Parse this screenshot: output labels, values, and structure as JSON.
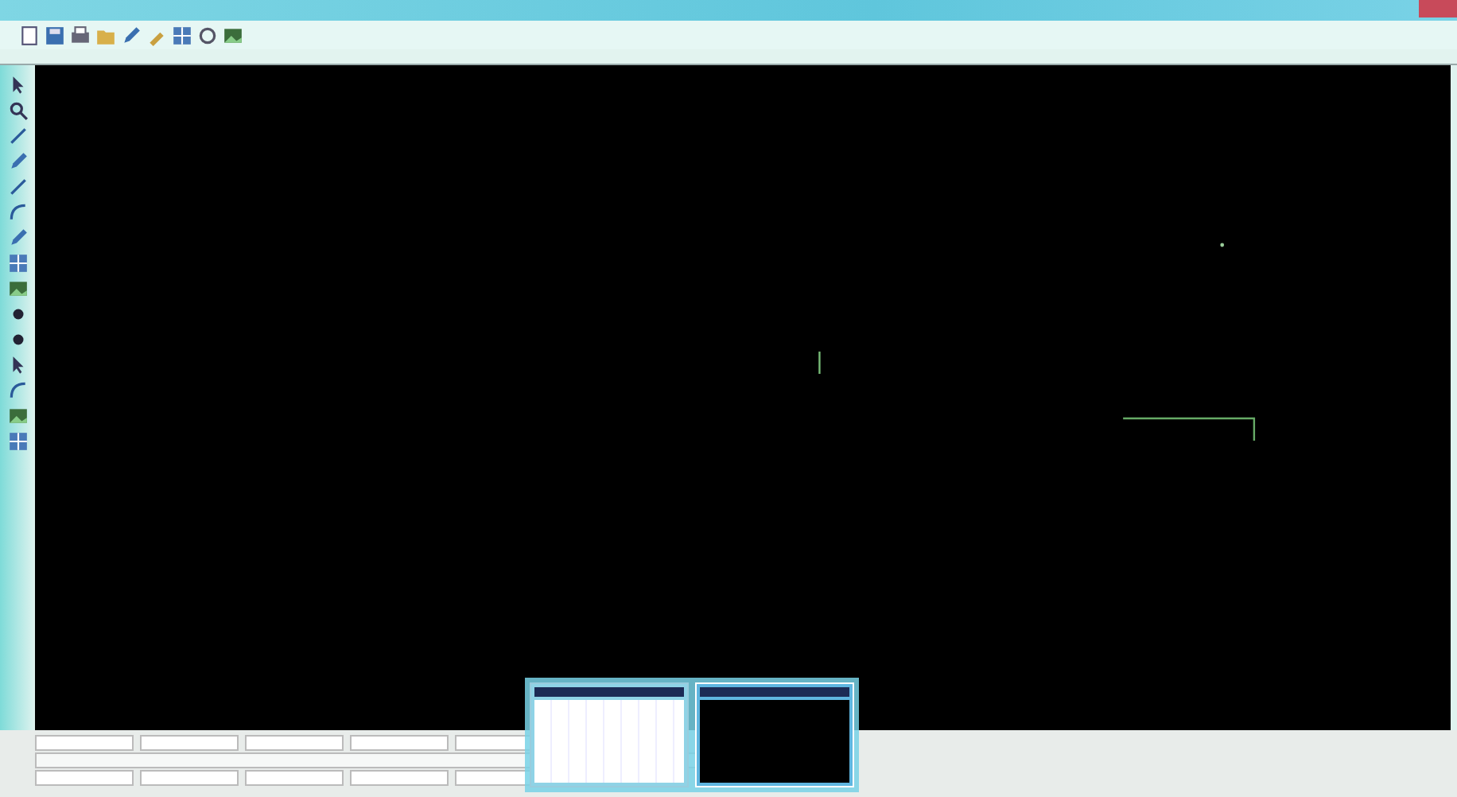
{
  "top_toolbar": [
    {
      "kind": "page"
    },
    {
      "kind": "save"
    },
    {
      "kind": "print"
    },
    {
      "kind": "folder"
    },
    {
      "kind": "pen"
    },
    {
      "kind": "tool"
    },
    {
      "kind": "grid"
    },
    {
      "kind": "circle"
    },
    {
      "kind": "image"
    }
  ],
  "side_toolbar": [
    {
      "kind": "cursor"
    },
    {
      "kind": "zoom"
    },
    {
      "kind": "line"
    },
    {
      "kind": "pen"
    },
    {
      "kind": "line"
    },
    {
      "kind": "arc"
    },
    {
      "kind": "pen"
    },
    {
      "kind": "grid"
    },
    {
      "kind": "image"
    },
    {
      "kind": "dot"
    },
    {
      "kind": "dot"
    },
    {
      "kind": "cursor"
    },
    {
      "kind": "arc"
    },
    {
      "kind": "image"
    },
    {
      "kind": "grid"
    }
  ],
  "canvas": {
    "kind": "drawing"
  },
  "command_rows": [
    {
      "kind": "fields"
    },
    {
      "kind": "line"
    },
    {
      "kind": "fields"
    }
  ],
  "thumbnails": [
    {
      "kind": "table",
      "selected": false
    },
    {
      "kind": "drawing",
      "selected": true
    }
  ]
}
